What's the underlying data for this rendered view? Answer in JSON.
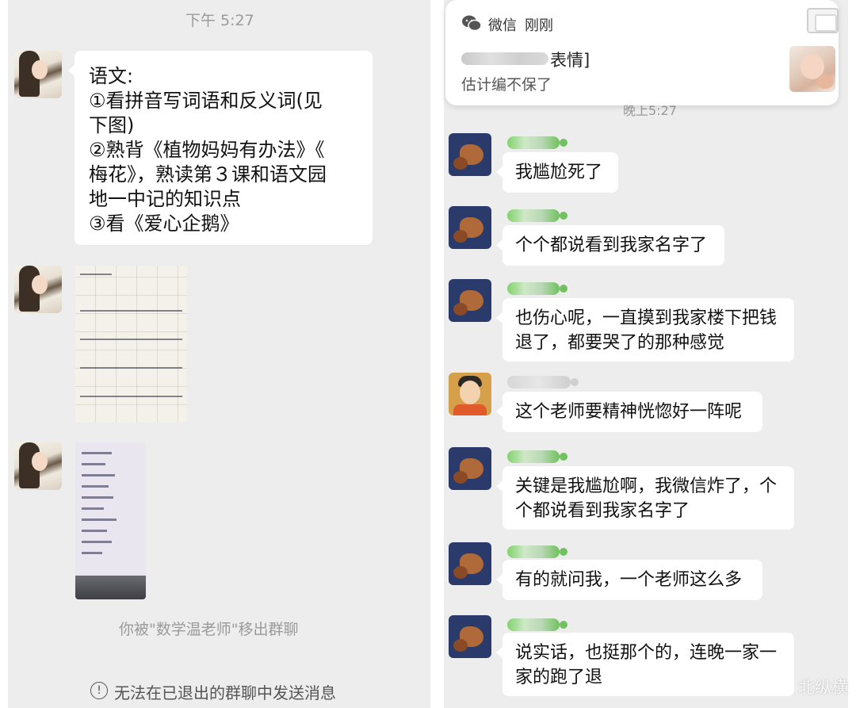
{
  "left_panel": {
    "time": "下午 5:27",
    "message_1_lines": [
      "语文:",
      "①看拼音写词语和反义词(见",
      "下图)",
      "②熟背《植物妈妈有办法》《",
      "梅花》，熟读第３课和语文园",
      "地一中记的知识点",
      "③看《爱心企鹅》"
    ],
    "system_notice": "你被\"数学温老师\"移出群聊",
    "footer_notice": "无法在已退出的群聊中发送消息",
    "footer_icon": "exclamation-circle-icon"
  },
  "notification": {
    "app_name": "微信",
    "time": "刚刚",
    "preview_suffix": "表情]",
    "preview_line2": "估计编不保了",
    "app_icon": "wechat-icon"
  },
  "right_panel": {
    "messages": [
      {
        "text_lines": [
          "我尴尬死了"
        ]
      },
      {
        "text_lines": [
          "个个都说看到我家名字了"
        ]
      },
      {
        "text_lines": [
          "也伤心呢，一直摸到我家楼下把钱",
          "退了，都要哭了的那种感觉"
        ]
      },
      {
        "text_lines": [
          "这个老师要精神恍惚好一阵呢"
        ]
      },
      {
        "text_lines": [
          "关键是我尴尬啊，我微信炸了，个",
          "个都说看到我家名字了"
        ]
      },
      {
        "text_lines": [
          "有的就问我，一个老师这么多"
        ]
      },
      {
        "text_lines": [
          "说实话，也挺那个的，连晚一家一",
          "家的跑了退"
        ]
      }
    ]
  },
  "watermark": "北纵横"
}
